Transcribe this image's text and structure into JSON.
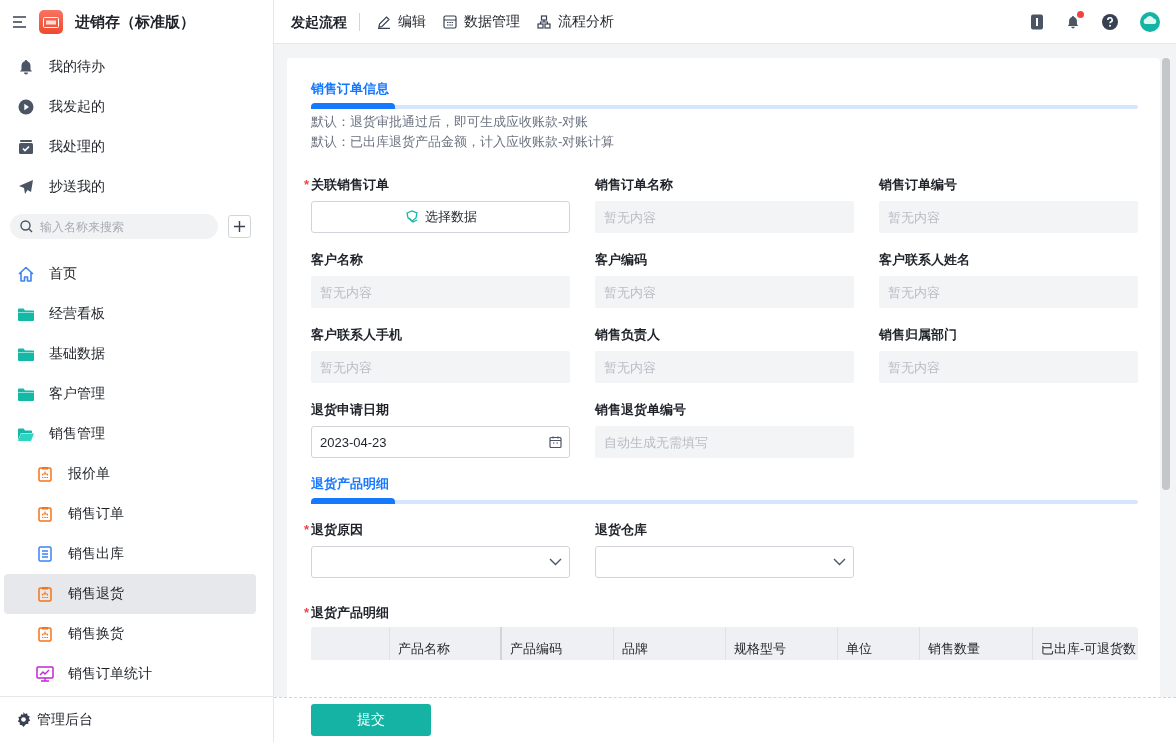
{
  "app": {
    "title": "进销存（标准版）"
  },
  "shortcuts": [
    {
      "label": "我的待办",
      "kind": "bell"
    },
    {
      "label": "我发起的",
      "kind": "play"
    },
    {
      "label": "我处理的",
      "kind": "check"
    },
    {
      "label": "抄送我的",
      "kind": "send"
    }
  ],
  "search": {
    "placeholder": "输入名称来搜索"
  },
  "menu": [
    {
      "label": "首页",
      "kind": "home",
      "selected": false
    },
    {
      "label": "经营看板",
      "kind": "folder",
      "expanded": false,
      "selected": false
    },
    {
      "label": "基础数据",
      "kind": "folder",
      "expanded": false,
      "selected": false
    },
    {
      "label": "客户管理",
      "kind": "folder",
      "expanded": false,
      "selected": false
    },
    {
      "label": "销售管理",
      "kind": "folder",
      "expanded": true,
      "selected": false,
      "children": [
        {
          "label": "报价单",
          "kind": "form",
          "selected": false
        },
        {
          "label": "销售订单",
          "kind": "form",
          "selected": false
        },
        {
          "label": "销售出库",
          "kind": "doc",
          "selected": false
        },
        {
          "label": "销售退货",
          "kind": "form",
          "selected": true
        },
        {
          "label": "销售换货",
          "kind": "form",
          "selected": false
        },
        {
          "label": "销售订单统计",
          "kind": "chart",
          "selected": false
        }
      ]
    }
  ],
  "admin": {
    "label": "管理后台"
  },
  "topbar": {
    "title": "发起流程",
    "actions": [
      {
        "label": "编辑",
        "kind": "edit"
      },
      {
        "label": "数据管理",
        "kind": "grid"
      },
      {
        "label": "流程分析",
        "kind": "flow"
      }
    ],
    "unread": true
  },
  "sections": [
    {
      "title": "销售订单信息",
      "notes": [
        "默认：退货审批通过后，即可生成应收账款-对账",
        "默认：已出库退货产品金额，计入应收账款-对账计算"
      ],
      "fields": [
        {
          "label": "关联销售订单",
          "required_mark": "*",
          "kind": "picker",
          "button": "选择数据"
        },
        {
          "label": "销售订单名称",
          "kind": "readonly",
          "placeholder": "暂无内容"
        },
        {
          "label": "销售订单编号",
          "kind": "readonly",
          "placeholder": "暂无内容"
        },
        {
          "label": "客户名称",
          "kind": "readonly",
          "placeholder": "暂无内容"
        },
        {
          "label": "客户编码",
          "kind": "readonly",
          "placeholder": "暂无内容"
        },
        {
          "label": "客户联系人姓名",
          "kind": "readonly",
          "placeholder": "暂无内容"
        },
        {
          "label": "客户联系人手机",
          "kind": "readonly",
          "placeholder": "暂无内容"
        },
        {
          "label": "销售负责人",
          "kind": "readonly",
          "placeholder": "暂无内容"
        },
        {
          "label": "销售归属部门",
          "kind": "readonly",
          "placeholder": "暂无内容"
        },
        {
          "label": "退货申请日期",
          "kind": "date",
          "value": "2023-04-23"
        },
        {
          "label": "销售退货单编号",
          "kind": "readonly",
          "placeholder": "自动生成无需填写"
        }
      ]
    },
    {
      "title": "退货产品明细",
      "fields": [
        {
          "label": "退货原因",
          "required_mark": "*",
          "kind": "select"
        },
        {
          "label": "退货仓库",
          "kind": "select"
        }
      ],
      "table": {
        "label": "退货产品明细",
        "required_mark": "*",
        "columns": [
          "产品名称",
          "产品编码",
          "品牌",
          "规格型号",
          "单位",
          "销售数量",
          "已出库-可退货数"
        ]
      }
    }
  ],
  "submit": "提交"
}
